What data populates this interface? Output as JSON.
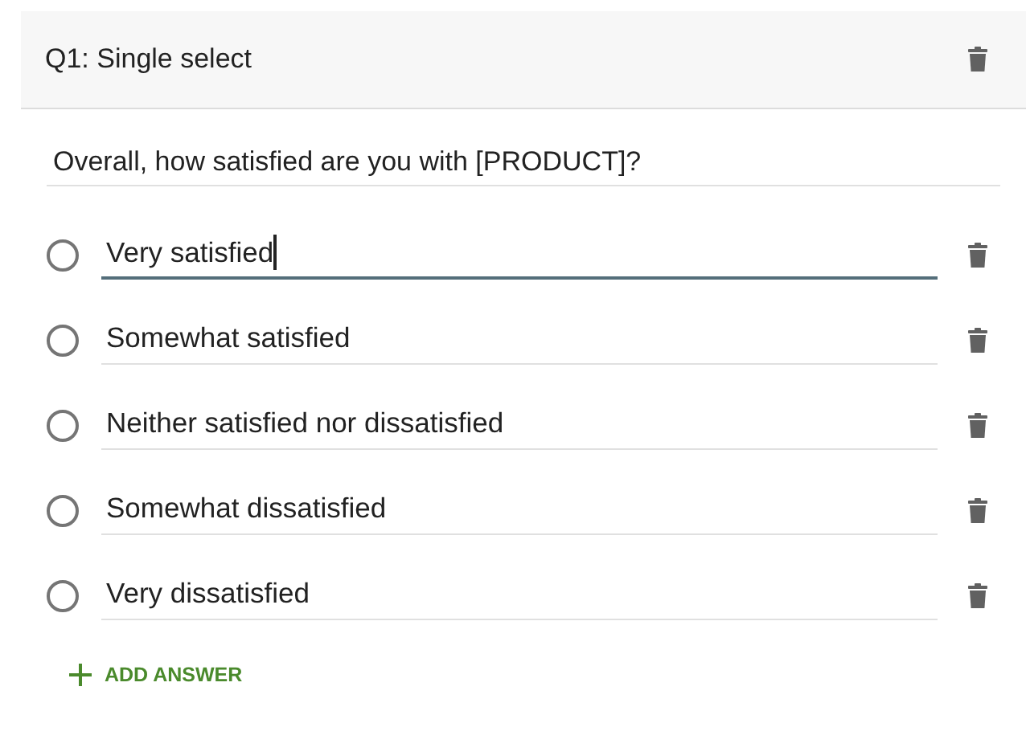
{
  "header": {
    "title": "Q1: Single select"
  },
  "question": {
    "value": "Overall, how satisfied are you with [PRODUCT]?"
  },
  "options": [
    {
      "value": "Very satisfied",
      "selected": false,
      "focused": true
    },
    {
      "value": "Somewhat satisfied",
      "selected": false,
      "focused": false
    },
    {
      "value": "Neither satisfied nor dissatisfied",
      "selected": false,
      "focused": false
    },
    {
      "value": "Somewhat dissatisfied",
      "selected": false,
      "focused": false
    },
    {
      "value": "Very dissatisfied",
      "selected": false,
      "focused": false
    }
  ],
  "add_button": {
    "label": "ADD ANSWER"
  }
}
